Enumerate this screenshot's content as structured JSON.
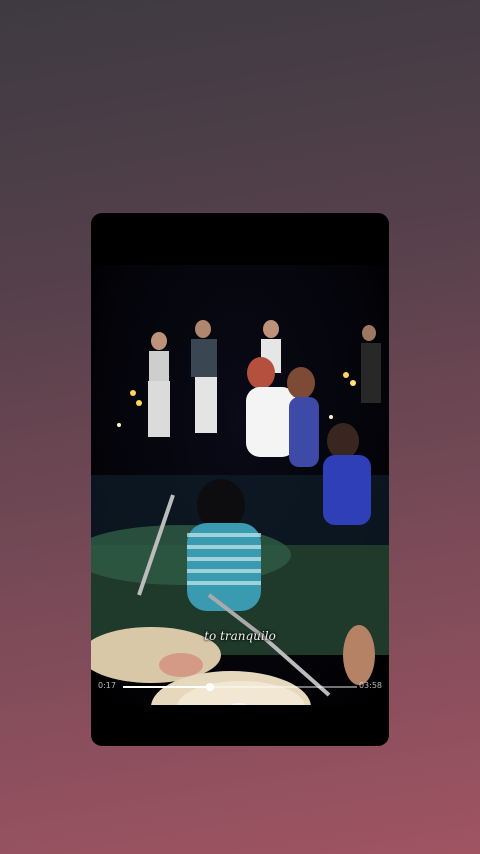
{
  "player": {
    "lyric": "to tranquilo",
    "current_time": "0:17",
    "duration": "03:58",
    "progress": 0.37
  },
  "controls": {
    "share": "share-icon",
    "rewind": "rewind-icon",
    "play": "play-icon",
    "forward": "fast-forward-icon",
    "like": "heart-icon"
  },
  "colors": {
    "accent": "#ffffff",
    "background_top": "#3e3a42",
    "background_bottom": "#a05462"
  }
}
